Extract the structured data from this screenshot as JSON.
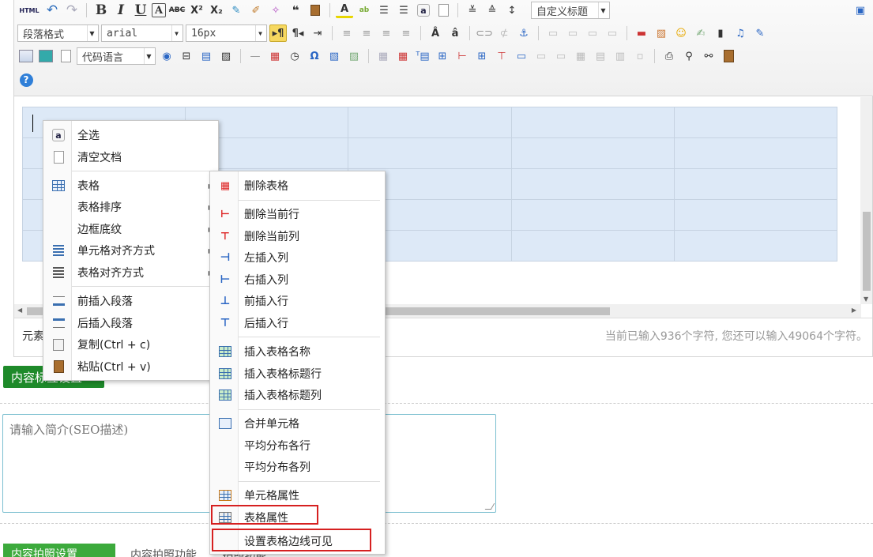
{
  "toolbar": {
    "row1": {
      "html_label": "HTML",
      "custom_title_select": "自定义标题"
    },
    "row2": {
      "paragraph_format": "段落格式",
      "font_family": "arial",
      "font_size": "16px"
    },
    "row3": {
      "code_language": "代码语言"
    }
  },
  "status": {
    "element_path": "元素",
    "char_count": "当前已输入936个字符, 您还可以输入49064个字符。"
  },
  "content_tag": "内容标签设置",
  "description": {
    "placeholder": "请输入简介(SEO描述)"
  },
  "bottom": {
    "button_label": "内容拍照设置",
    "text": "内容拍照功能…    …拍照功能"
  },
  "context_menu": {
    "items": [
      {
        "icon": "select-all-icon",
        "label": "全选"
      },
      {
        "icon": "clear-doc-icon",
        "label": "清空文档"
      },
      {
        "icon": "table-icon",
        "label": "表格",
        "submenu": true
      },
      {
        "icon": "",
        "label": "表格排序",
        "submenu": true
      },
      {
        "icon": "",
        "label": "边框底纹",
        "submenu": true
      },
      {
        "icon": "cell-align-icon",
        "label": "单元格对齐方式",
        "submenu": true
      },
      {
        "icon": "table-align-icon",
        "label": "表格对齐方式",
        "submenu": true
      },
      {
        "icon": "insert-para-before-icon",
        "label": "前插入段落"
      },
      {
        "icon": "insert-para-after-icon",
        "label": "后插入段落"
      },
      {
        "icon": "copy-icon",
        "label": "复制(Ctrl + c)"
      },
      {
        "icon": "paste-icon",
        "label": "粘贴(Ctrl + v)"
      }
    ]
  },
  "table_submenu": {
    "items": [
      {
        "icon": "delete-table-icon",
        "label": "删除表格"
      },
      {
        "icon": "delete-row-icon",
        "label": "删除当前行"
      },
      {
        "icon": "delete-col-icon",
        "label": "删除当前列"
      },
      {
        "icon": "insert-col-left-icon",
        "label": "左插入列"
      },
      {
        "icon": "insert-col-right-icon",
        "label": "右插入列"
      },
      {
        "icon": "insert-row-before-icon",
        "label": "前插入行"
      },
      {
        "icon": "insert-row-after-icon",
        "label": "后插入行"
      },
      {
        "icon": "insert-caption-icon",
        "label": "插入表格名称"
      },
      {
        "icon": "insert-title-row-icon",
        "label": "插入表格标题行"
      },
      {
        "icon": "insert-title-col-icon",
        "label": "插入表格标题列"
      },
      {
        "icon": "merge-cells-icon",
        "label": "合并单元格"
      },
      {
        "icon": "",
        "label": "平均分布各行"
      },
      {
        "icon": "",
        "label": "平均分布各列"
      },
      {
        "icon": "cell-props-icon",
        "label": "单元格属性"
      },
      {
        "icon": "table-props-icon",
        "label": "表格属性"
      },
      {
        "icon": "",
        "label": "设置表格边线可见"
      }
    ]
  },
  "colors": {
    "accent_green": "#1e8a2a",
    "highlight_red": "#d62020",
    "table_fill": "#dde9f7"
  }
}
